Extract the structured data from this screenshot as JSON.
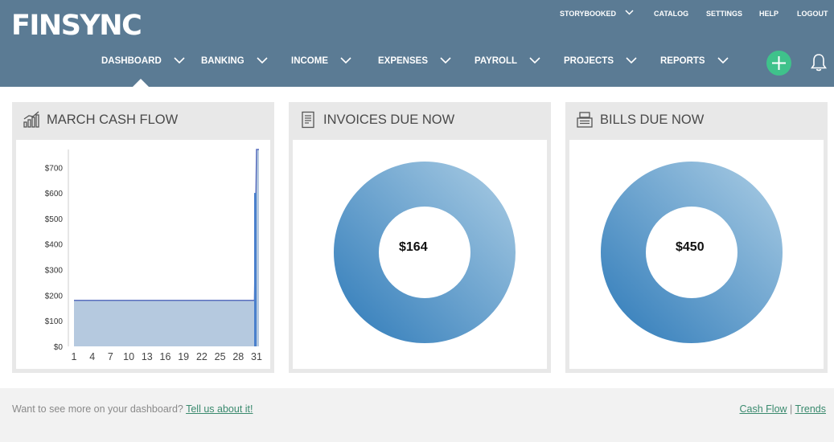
{
  "brand": {
    "logo_text": "FINSYNC"
  },
  "utility_nav": {
    "company": "STORYBOOKED",
    "catalog": "CATALOG",
    "settings": "SETTINGS",
    "help": "HELP",
    "logout": "LOGOUT"
  },
  "main_nav": {
    "active": "DASHBOARD",
    "items": [
      "DASHBOARD",
      "BANKING",
      "INCOME",
      "EXPENSES",
      "PAYROLL",
      "PROJECTS",
      "REPORTS"
    ]
  },
  "colors": {
    "header_bg": "#5b7b94",
    "accent_green": "#3fc28b",
    "chart_fill": "#b5c9df",
    "chart_line": "#5a6fbf",
    "donut_blue": "#5a98c8",
    "link_green": "#3a8a6e"
  },
  "panels": {
    "cash_flow": {
      "title": "MARCH CASH FLOW",
      "icon": "bar-chart-icon"
    },
    "invoices": {
      "title": "INVOICES DUE NOW",
      "icon": "document-icon",
      "amount": "$164"
    },
    "bills": {
      "title": "BILLS DUE NOW",
      "icon": "cash-register-icon",
      "amount": "$450"
    }
  },
  "chart_data": {
    "type": "area",
    "title": "MARCH CASH FLOW",
    "x": [
      1,
      2,
      3,
      4,
      5,
      6,
      7,
      8,
      9,
      10,
      11,
      12,
      13,
      14,
      15,
      16,
      17,
      18,
      19,
      20,
      21,
      22,
      23,
      24,
      25,
      26,
      27,
      28,
      29,
      30,
      31
    ],
    "values": [
      180,
      180,
      180,
      180,
      180,
      180,
      180,
      180,
      180,
      180,
      180,
      180,
      180,
      180,
      180,
      180,
      180,
      180,
      180,
      180,
      180,
      180,
      180,
      180,
      180,
      180,
      180,
      180,
      180,
      180,
      770
    ],
    "spike_bar": {
      "x": 31,
      "value": 600
    },
    "x_ticks": [
      "1",
      "4",
      "7",
      "10",
      "13",
      "16",
      "19",
      "22",
      "25",
      "28",
      "31"
    ],
    "y_ticks": [
      "$0",
      "$100",
      "$200",
      "$300",
      "$400",
      "$500",
      "$600",
      "$700"
    ],
    "ylim": [
      0,
      770
    ],
    "xlabel": "",
    "ylabel": "",
    "grid": false
  },
  "footer": {
    "prompt": "Want to see more on your dashboard?",
    "prompt_link": "Tell us about it!",
    "link_cashflow": "Cash Flow",
    "separator": "|",
    "link_trends": "Trends"
  }
}
